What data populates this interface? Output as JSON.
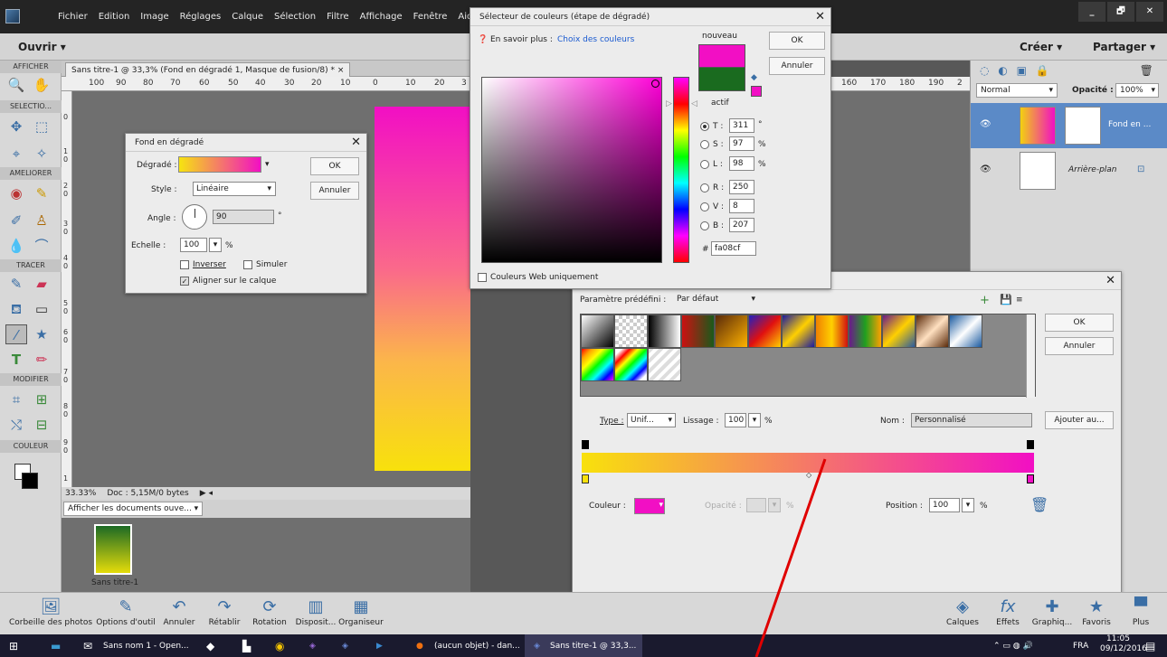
{
  "menubar": {
    "items": [
      "Fichier",
      "Edition",
      "Image",
      "Réglages",
      "Calque",
      "Sélection",
      "Filtre",
      "Affichage",
      "Fenêtre",
      "Aide"
    ],
    "window_buttons": [
      "_",
      "🗗",
      "✕"
    ]
  },
  "bar2": {
    "open": "Ouvrir  ▾",
    "create": "Créer  ▾",
    "share": "Partager  ▾"
  },
  "toolbar": {
    "sections": [
      "AFFICHER",
      "SELECTIO...",
      "AMELIORER",
      "TRACER",
      "MODIFIER",
      "COULEUR"
    ]
  },
  "document": {
    "tab_title": "Sans titre-1 @ 33,3% (Fond en dégradé 1, Masque de fusion/8) *  ×",
    "ruler_top": [
      "100",
      "90",
      "80",
      "70",
      "60",
      "50",
      "40",
      "30",
      "20",
      "10",
      "0",
      "10",
      "20",
      "3"
    ],
    "ruler_top_right": [
      "160",
      "170",
      "180",
      "190",
      "2"
    ],
    "ruler_left": [
      "0",
      "1\n0",
      "2\n0",
      "3\n0",
      "4\n0",
      "5\n0",
      "6\n0",
      "7\n0",
      "8\n0",
      "9\n0",
      "1"
    ],
    "status_zoom": "33.33%",
    "status_doc": "Doc : 5,15M/0 bytes",
    "docs_dropdown": "Afficher les documents ouve...  ▾",
    "thumb_caption": "Sans titre-1"
  },
  "fill_dialog": {
    "title": "Fond en dégradé",
    "gradient_label": "Dégradé :",
    "style_label": "Style :",
    "style_value": "Linéaire",
    "angle_label": "Angle :",
    "angle_value": "90",
    "angle_unit": "°",
    "scale_label": "Echelle :",
    "scale_value": "100",
    "scale_unit": "%",
    "invert": "Inverser",
    "dither": "Simuler",
    "align": "Aligner sur le calque",
    "ok": "OK",
    "cancel": "Annuler"
  },
  "color_picker": {
    "title": "Sélecteur de couleurs (étape de dégradé)",
    "learn_more": "En savoir plus :",
    "learn_link": "Choix des couleurs",
    "new_label": "nouveau",
    "current_label": "actif",
    "ok": "OK",
    "cancel": "Annuler",
    "h_label": "T :",
    "h_value": "311",
    "h_unit": "°",
    "s_label": "S :",
    "s_value": "97",
    "s_unit": "%",
    "l_label": "L :",
    "l_value": "98",
    "l_unit": "%",
    "r_label": "R :",
    "r_value": "250",
    "g_label": "V :",
    "g_value": "8",
    "b_label": "B :",
    "b_value": "207",
    "hex_label": "#",
    "hex_value": "fa08cf",
    "web_only": "Couleurs Web uniquement",
    "new_color": "#f20fc4",
    "current_color": "#1a6b1f"
  },
  "gradient_editor": {
    "preset_label": "Paramètre prédéfini :",
    "preset_value": "Par défaut",
    "ok": "OK",
    "cancel": "Annuler",
    "type_label": "Type :",
    "type_value": "Unif...",
    "smooth_label": "Lissage :",
    "smooth_value": "100",
    "smooth_unit": "%",
    "name_label": "Nom :",
    "name_value": "Personnalisé",
    "add_button": "Ajouter au...",
    "color_label": "Couleur :",
    "opacity_label": "Opacité :",
    "opacity_unit": "%",
    "position_label": "Position :",
    "position_value": "100",
    "position_unit": "%"
  },
  "layers": {
    "blend_mode": "Normal",
    "opacity_label": "Opacité :",
    "opacity_value": "100%",
    "layer1": "Fond en ...",
    "layer2": "Arrière-plan"
  },
  "bottom_bar": {
    "items": [
      "Corbeille des photos",
      "Options d'outil",
      "Annuler",
      "Rétablir",
      "Rotation",
      "Disposit...",
      "Organiseur"
    ],
    "right_items": [
      "Calques",
      "Effets",
      "Graphiq...",
      "Favoris",
      "Plus"
    ]
  },
  "taskbar": {
    "task1": "Sans nom 1 - Open...",
    "task2": "(aucun objet) - dan...",
    "task3": "Sans titre-1 @ 33,3...",
    "lang": "FRA",
    "time": "11:05",
    "date": "09/12/2016"
  }
}
